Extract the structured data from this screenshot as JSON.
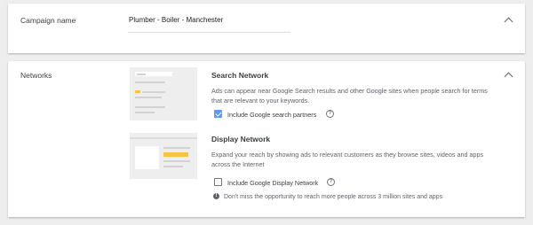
{
  "campaign_name_section": {
    "label": "Campaign name",
    "value": "Plumber - Boiler - Manchester"
  },
  "networks_section": {
    "label": "Networks",
    "search_network": {
      "title": "Search Network",
      "description": "Ads can appear near Google Search results and other Google sites when people search for terms that are relevant to your keywords.",
      "checkbox_label": "Include Google search partners",
      "checked": true
    },
    "display_network": {
      "title": "Display Network",
      "description": "Expand your reach by showing ads to relevant customers as they browse sites, videos and apps across the Internet",
      "checkbox_label": "Include Google Display Network",
      "checked": false,
      "info_text": "Don't miss the opportunity to reach more people across 3 million sites and apps"
    }
  },
  "icons": {
    "collapse": "chevron-up-icon",
    "help": "help-circle-icon",
    "info": "info-icon",
    "help_glyph": "?",
    "info_glyph": "!"
  },
  "colors": {
    "accent": "#5e97f6",
    "highlight": "#f6c343",
    "background": "#eeeeee"
  }
}
